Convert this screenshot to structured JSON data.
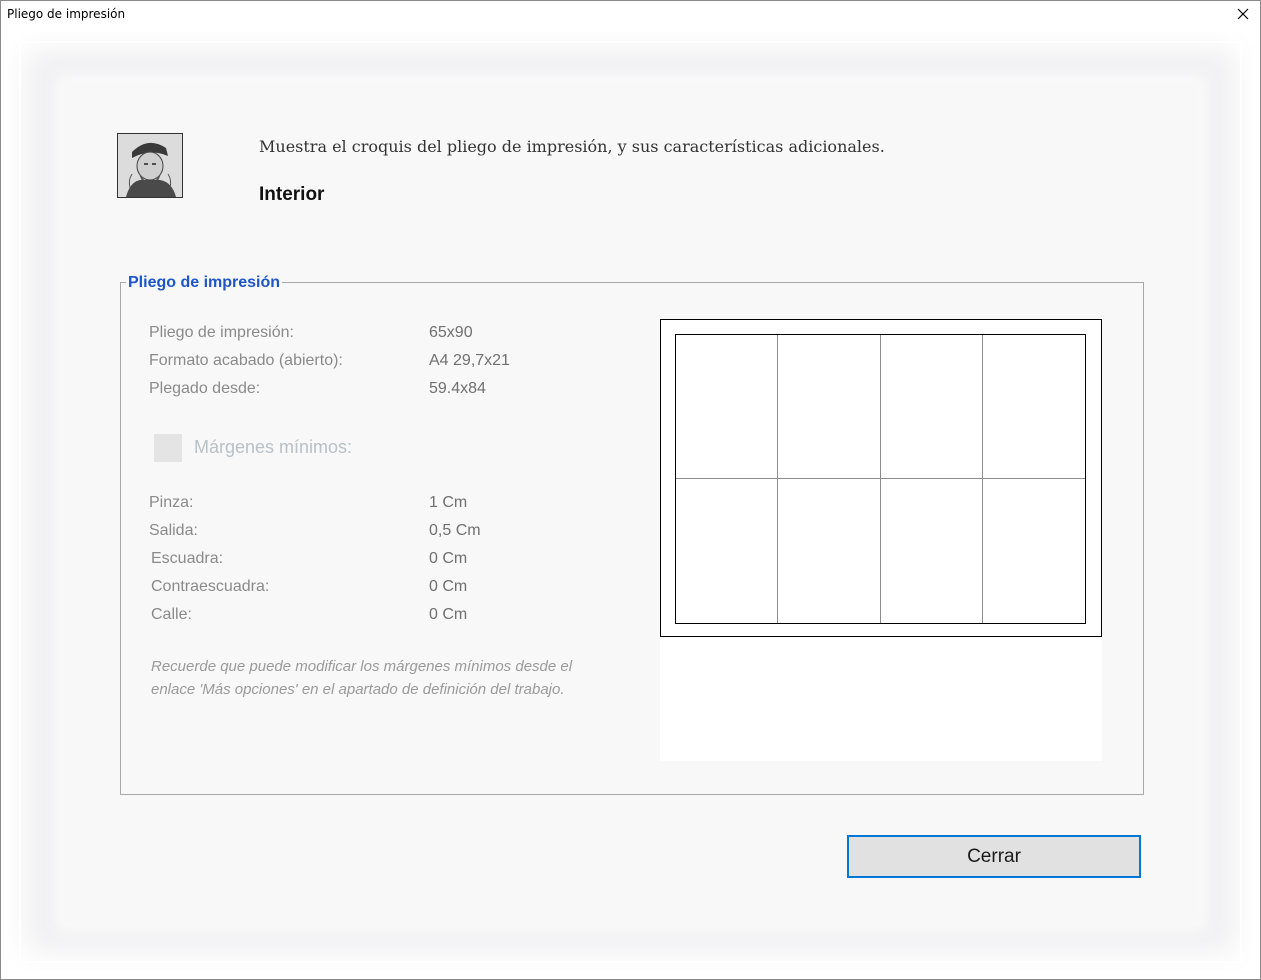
{
  "window": {
    "title": "Pliego de impresión",
    "close_icon": "close-icon"
  },
  "header": {
    "description": "Muestra el croquis del pliego de impresión, y sus características adicionales.",
    "subtitle": "Interior",
    "avatar_icon": "engraved-portrait-image"
  },
  "group": {
    "legend": "Pliego de impresión",
    "rows": [
      {
        "label": "Pliego de impresión:",
        "value": "65x90"
      },
      {
        "label": "Formato acabado (abierto):",
        "value": "A4 29,7x21"
      },
      {
        "label": "Plegado desde:",
        "value": "59.4x84"
      }
    ],
    "margins_checkbox": {
      "label": "Márgenes mínimos:",
      "checked": false
    },
    "margins": [
      {
        "label": "Pinza:",
        "value": "1 Cm"
      },
      {
        "label": "Salida:",
        "value": "0,5 Cm"
      },
      {
        "label": "Escuadra:",
        "value": "0 Cm"
      },
      {
        "label": "Contraescuadra:",
        "value": "0 Cm"
      },
      {
        "label": "Calle:",
        "value": "0 Cm"
      }
    ],
    "note": "Recuerde que puede modificar los márgenes mínimos desde el enlace 'Más opciones' en el apartado de definición del trabajo."
  },
  "sketch": {
    "columns": 4,
    "rows": 2
  },
  "footer": {
    "close_label": "Cerrar"
  },
  "colors": {
    "accent": "#0078d7",
    "legend": "#1e55c8"
  }
}
